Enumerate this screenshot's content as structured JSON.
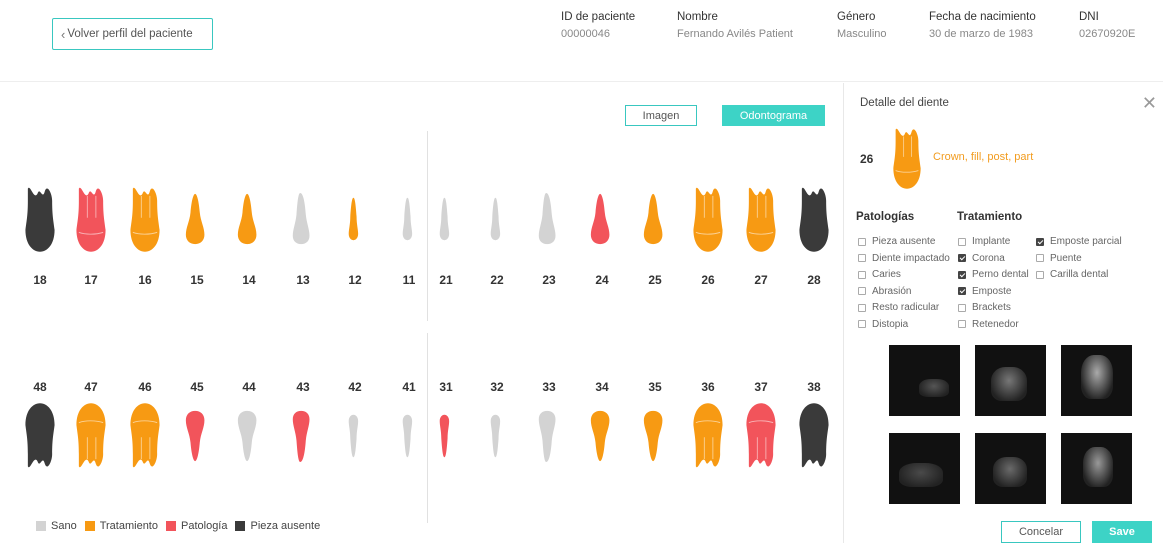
{
  "header": {
    "back_label": "Volver perfil del paciente",
    "fields": [
      {
        "label": "ID de paciente",
        "value": "00000046"
      },
      {
        "label": "Nombre",
        "value": "Fernando Avilés Patient"
      },
      {
        "label": "Género",
        "value": "Masculino"
      },
      {
        "label": "Fecha de nacimiento",
        "value": "30 de marzo de 1983"
      },
      {
        "label": "DNI",
        "value": "02670920E"
      }
    ]
  },
  "view": {
    "imagen_label": "Imagen",
    "odontograma_label": "Odontograma",
    "active": "odontograma"
  },
  "colors": {
    "sano": "#d3d3d3",
    "tratamiento": "#f79a13",
    "patologia": "#f2545b",
    "ausente": "#3a3a3a",
    "accent": "#3dd3c6"
  },
  "upper_teeth": [
    {
      "number": "18",
      "status": "ausente",
      "icon": "molar-icon"
    },
    {
      "number": "17",
      "status": "patologia",
      "icon": "molar-icon"
    },
    {
      "number": "16",
      "status": "tratamiento",
      "icon": "molar-icon"
    },
    {
      "number": "15",
      "status": "tratamiento",
      "icon": "premolar-icon"
    },
    {
      "number": "14",
      "status": "tratamiento",
      "icon": "premolar-icon"
    },
    {
      "number": "13",
      "status": "sano",
      "icon": "canine-icon"
    },
    {
      "number": "12",
      "status": "tratamiento",
      "icon": "incisor-icon"
    },
    {
      "number": "11",
      "status": "sano",
      "icon": "incisor-icon"
    },
    {
      "number": "21",
      "status": "sano",
      "icon": "incisor-icon"
    },
    {
      "number": "22",
      "status": "sano",
      "icon": "incisor-icon"
    },
    {
      "number": "23",
      "status": "sano",
      "icon": "canine-icon"
    },
    {
      "number": "24",
      "status": "patologia",
      "icon": "premolar-icon"
    },
    {
      "number": "25",
      "status": "tratamiento",
      "icon": "premolar-icon"
    },
    {
      "number": "26",
      "status": "tratamiento",
      "icon": "molar-icon"
    },
    {
      "number": "27",
      "status": "tratamiento",
      "icon": "molar-icon"
    },
    {
      "number": "28",
      "status": "ausente",
      "icon": "molar-icon"
    }
  ],
  "lower_teeth": [
    {
      "number": "48",
      "status": "ausente",
      "icon": "molar-icon"
    },
    {
      "number": "47",
      "status": "tratamiento",
      "icon": "molar-icon"
    },
    {
      "number": "46",
      "status": "tratamiento",
      "icon": "molar-icon"
    },
    {
      "number": "45",
      "status": "patologia",
      "icon": "premolar-icon"
    },
    {
      "number": "44",
      "status": "sano",
      "icon": "premolar-icon"
    },
    {
      "number": "43",
      "status": "patologia",
      "icon": "canine-icon"
    },
    {
      "number": "42",
      "status": "sano",
      "icon": "incisor-icon"
    },
    {
      "number": "41",
      "status": "sano",
      "icon": "incisor-icon"
    },
    {
      "number": "31",
      "status": "patologia",
      "icon": "incisor-icon"
    },
    {
      "number": "32",
      "status": "sano",
      "icon": "incisor-icon"
    },
    {
      "number": "33",
      "status": "sano",
      "icon": "canine-icon"
    },
    {
      "number": "34",
      "status": "tratamiento",
      "icon": "premolar-icon"
    },
    {
      "number": "35",
      "status": "tratamiento",
      "icon": "premolar-icon"
    },
    {
      "number": "36",
      "status": "tratamiento",
      "icon": "molar-icon"
    },
    {
      "number": "37",
      "status": "patologia",
      "icon": "molar-icon"
    },
    {
      "number": "38",
      "status": "ausente",
      "icon": "molar-icon"
    }
  ],
  "legend": [
    {
      "key": "sano",
      "label": "Sano"
    },
    {
      "key": "tratamiento",
      "label": "Tratamiento"
    },
    {
      "key": "patologia",
      "label": "Patología"
    },
    {
      "key": "ausente",
      "label": "Pieza ausente"
    }
  ],
  "detail": {
    "title": "Detalle del diente",
    "tooth_number": "26",
    "tooth_status": "tratamiento",
    "description": "Crown, fill, post, part",
    "patologias_title": "Patologías",
    "tratamiento_title": "Tratamiento",
    "patologias": [
      {
        "label": "Pieza ausente",
        "checked": false
      },
      {
        "label": "Diente impactado",
        "checked": false
      },
      {
        "label": "Caries",
        "checked": false
      },
      {
        "label": "Abrasión",
        "checked": false
      },
      {
        "label": "Resto radicular",
        "checked": false
      },
      {
        "label": "Distopia",
        "checked": false
      }
    ],
    "tratamientos_a": [
      {
        "label": "Implante",
        "checked": false
      },
      {
        "label": "Corona",
        "checked": true
      },
      {
        "label": "Perno dental",
        "checked": true
      },
      {
        "label": "Emposte",
        "checked": true
      },
      {
        "label": "Brackets",
        "checked": false
      },
      {
        "label": "Retenedor",
        "checked": false
      }
    ],
    "tratamientos_b": [
      {
        "label": "Emposte parcial",
        "checked": true
      },
      {
        "label": "Puente",
        "checked": false
      },
      {
        "label": "Carilla dental",
        "checked": false
      }
    ],
    "xray_count": 6,
    "cancel_label": "Concelar",
    "save_label": "Save"
  }
}
